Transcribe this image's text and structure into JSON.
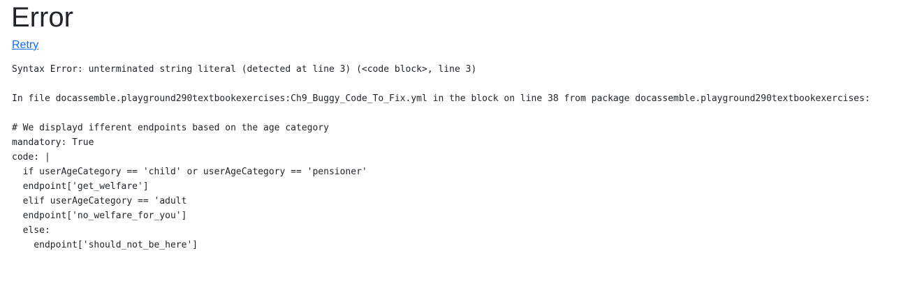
{
  "page": {
    "title": "Error",
    "retry_label": "Retry",
    "error_message": "Syntax Error: unterminated string literal (detected at line 3) (<code block>, line 3)\n\nIn file docassemble.playground290textbookexercises:Ch9_Buggy_Code_To_Fix.yml in the block on line 38 from package docassemble.playground290textbookexercises:\n\n# We displayd ifferent endpoints based on the age category\nmandatory: True\ncode: |\n  if userAgeCategory == 'child' or userAgeCategory == 'pensioner'\n  endpoint['get_welfare']\n  elif userAgeCategory == 'adult\n  endpoint['no_welfare_for_you']\n  else:\n    endpoint['should_not_be_here']"
  }
}
